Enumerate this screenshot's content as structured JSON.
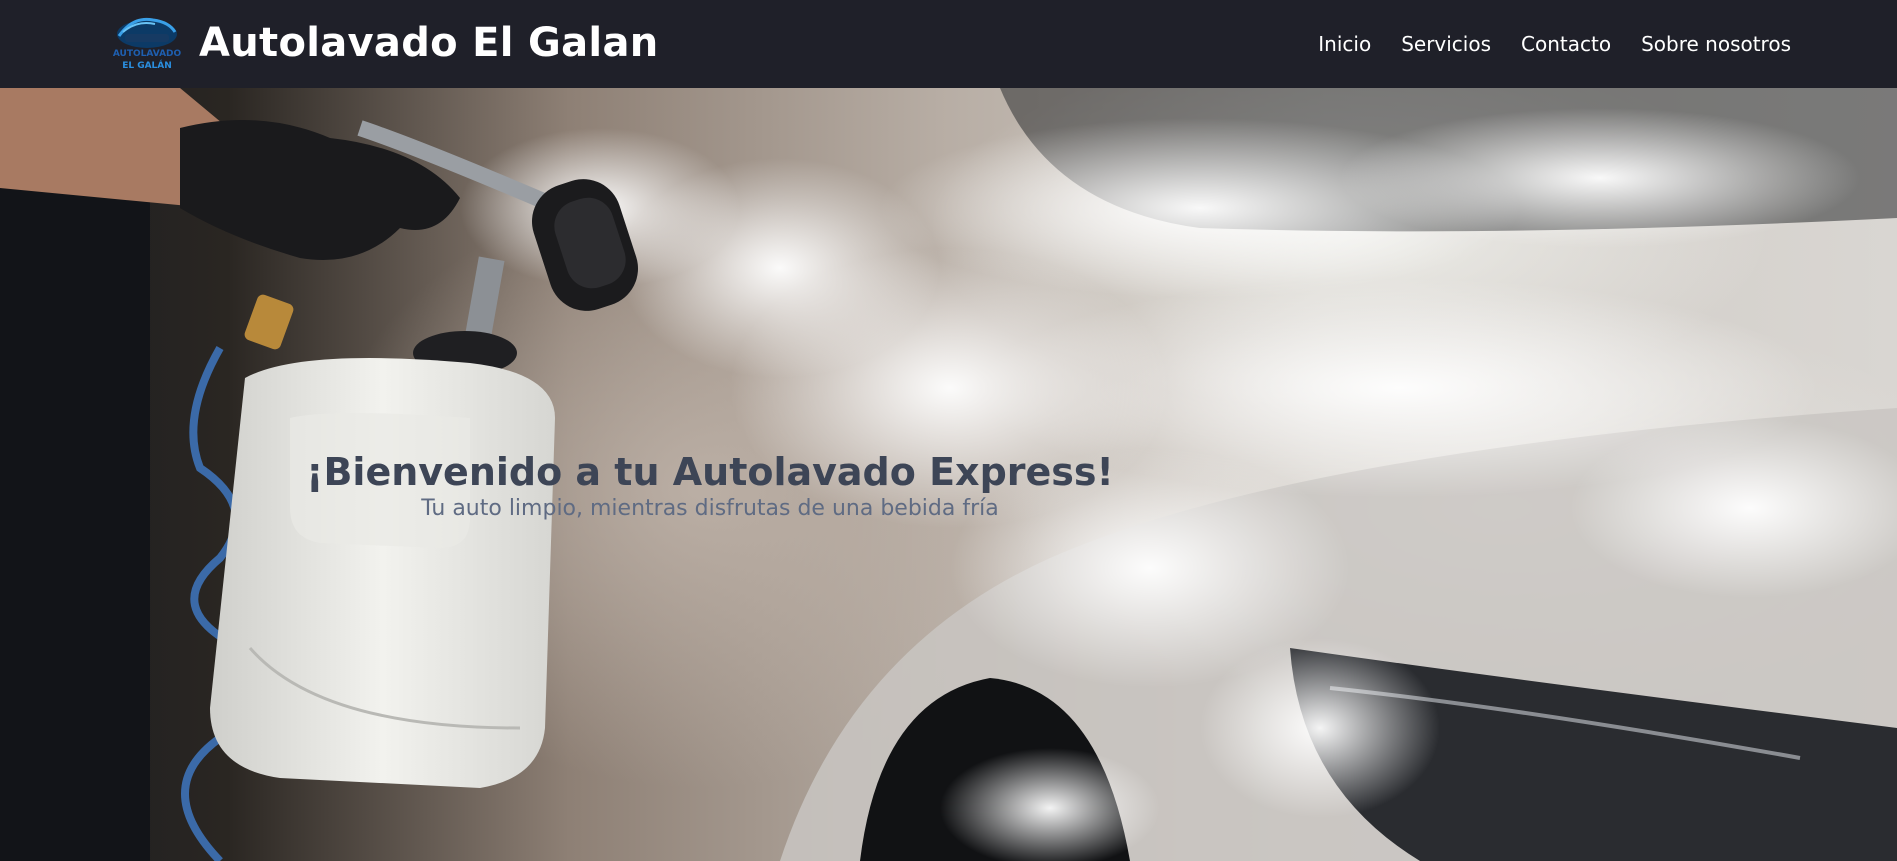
{
  "header": {
    "logo_text_line1": "AUTOLAVADO",
    "logo_text_line2": "EL GALÁN",
    "brand_name": "Autolavado El Galan",
    "nav": [
      {
        "label": "Inicio"
      },
      {
        "label": "Servicios"
      },
      {
        "label": "Contacto"
      },
      {
        "label": "Sobre nosotros"
      }
    ]
  },
  "hero": {
    "title": "¡Bienvenido a tu Autolavado Express!",
    "subtitle": "Tu auto limpio, mientras disfrutas de una bebida fría"
  },
  "colors": {
    "navbar_bg": "#1f2029",
    "title_color": "#3d4556",
    "subtitle_color": "#5f6b83"
  }
}
